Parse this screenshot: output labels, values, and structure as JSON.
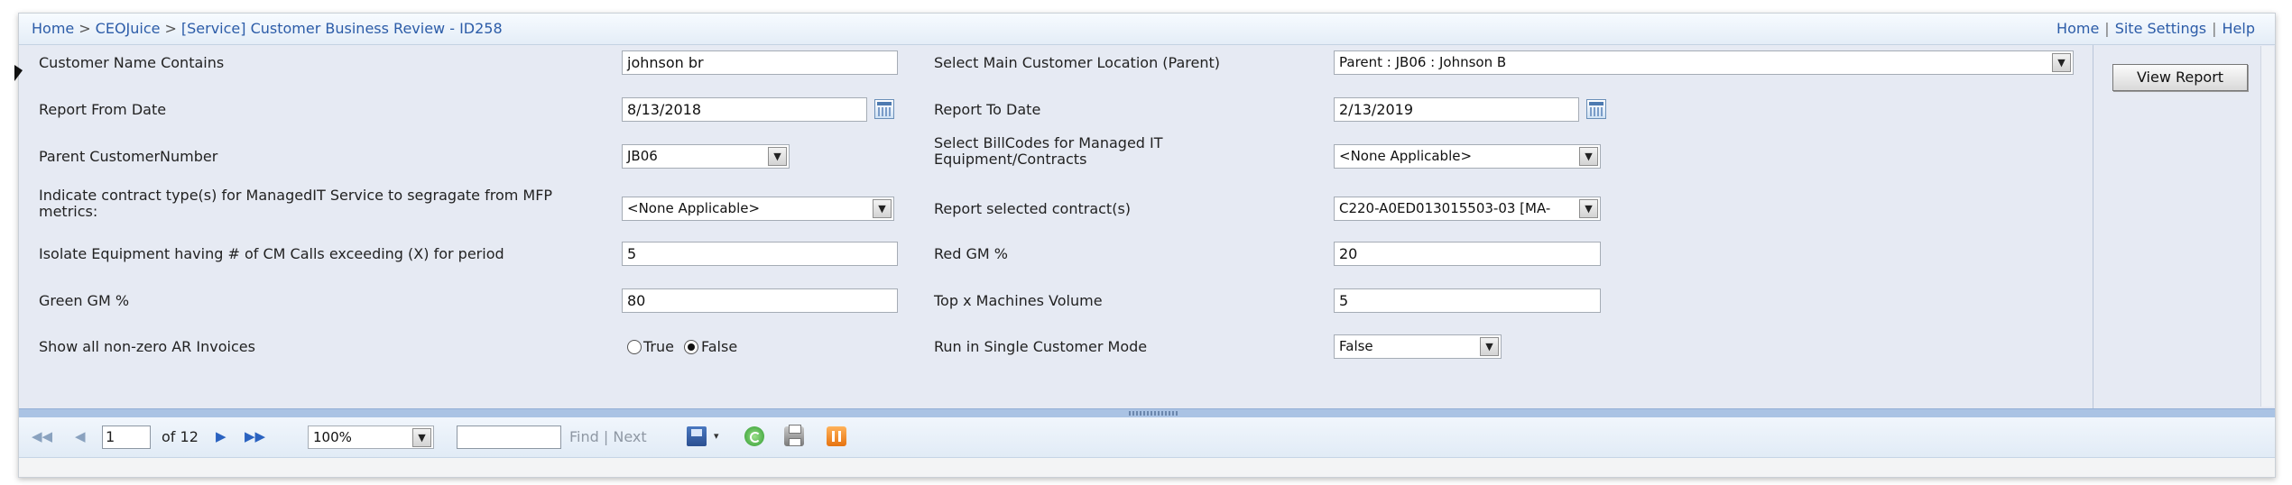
{
  "breadcrumb": {
    "home": "Home",
    "sep": ">",
    "site": "CEOJuice",
    "page": "[Service] Customer Business Review - ID258"
  },
  "toplinks": {
    "home": "Home",
    "settings": "Site Settings",
    "help": "Help",
    "sep": "|"
  },
  "params": {
    "customer_name": {
      "label": "Customer Name Contains",
      "value": "johnson br"
    },
    "main_location": {
      "label": "Select Main Customer Location (Parent)",
      "value": "Parent : JB06 : Johnson B"
    },
    "from_date": {
      "label": "Report From Date",
      "value": "8/13/2018"
    },
    "to_date": {
      "label": "Report To Date",
      "value": "2/13/2019"
    },
    "parent_customer": {
      "label": "Parent CustomerNumber",
      "value": "JB06"
    },
    "billcodes": {
      "label_line1": "Select BillCodes for Managed IT",
      "label_line2": "Equipment/Contracts",
      "value": "<None Applicable>"
    },
    "contract_type": {
      "label_line1": "Indicate contract type(s) for ManagedIT Service to segragate from MFP",
      "label_line2": "metrics:",
      "value": "<None Applicable>"
    },
    "selected_contracts": {
      "label": "Report selected contract(s)",
      "value": "C220-A0ED013015503-03 [MA-"
    },
    "isolate_equipment": {
      "label": "Isolate Equipment having # of CM Calls exceeding (X) for period",
      "value": "5"
    },
    "red_gm": {
      "label": "Red GM %",
      "value": "20"
    },
    "green_gm": {
      "label": "Green GM %",
      "value": "80"
    },
    "top_x": {
      "label": "Top x Machines Volume",
      "value": "5"
    },
    "ar_invoices": {
      "label": "Show all non-zero AR Invoices",
      "true_label": "True",
      "false_label": "False"
    },
    "single_customer": {
      "label": "Run in Single Customer Mode",
      "value": "False"
    }
  },
  "view_report": "View Report",
  "toolbar": {
    "first": "◀◀",
    "prev": "◀",
    "page": "1",
    "of_pages": "of 12",
    "next": "▶",
    "last": "▶▶",
    "zoom": "100%",
    "find": "Find",
    "find_sep": "|",
    "next_link": "Next",
    "export_arrow": "▾"
  }
}
